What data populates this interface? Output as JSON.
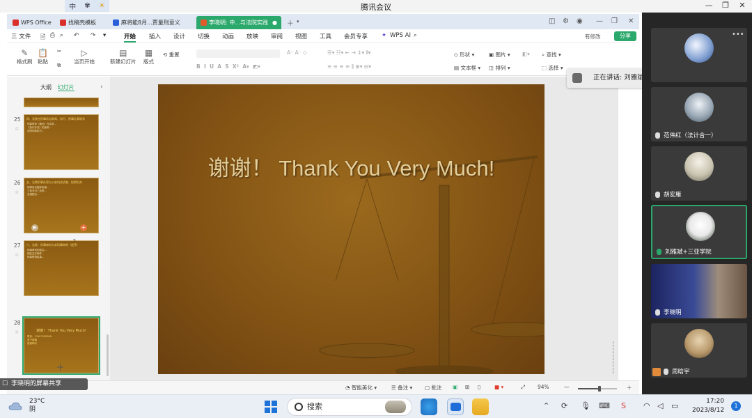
{
  "meeting": {
    "title": "腾讯会议",
    "ime_lang": "中",
    "speaker_toast": "正在讲话: 刘雅斌+三亚学院",
    "screen_share_label": "李晓明的屏幕共享"
  },
  "wps": {
    "tabs": [
      {
        "label": "WPS Office",
        "icon_color": "#d9302b"
      },
      {
        "label": "找稿壳模板",
        "icon_color": "#d9302b"
      },
      {
        "label": "麻将能8月...贾量刑意义",
        "icon_color": "#2b5fd9"
      },
      {
        "label": "李晓明: 中...与法院实践",
        "icon_color": "#e05a2b",
        "active": true
      }
    ],
    "menu": {
      "file": "三 文件",
      "items": [
        "开始",
        "插入",
        "设计",
        "切换",
        "动画",
        "放映",
        "审阅",
        "视图",
        "工具",
        "会员专享"
      ],
      "active": "开始",
      "ai": "WPS AI",
      "collab": "有修改",
      "share": "分享"
    },
    "ribbon": {
      "format_painter": "格式刷",
      "paste": "粘贴",
      "play_from_current": "当页开始",
      "new_slide": "新建幻灯片",
      "layout": "版式",
      "reset": "重置",
      "shape": "形状",
      "picture": "图片",
      "textbox": "文本框",
      "arrange": "排列",
      "find": "查找",
      "select": "选择"
    },
    "panel": {
      "tab_outline": "大纲",
      "tab_slides": "幻灯片",
      "thumbnails": [
        {
          "num": "25",
          "title": "四、法院在刑事诉讼审判、执行、刑事办案联系",
          "lines": [
            "刑事审判（裁判）在实质...",
            "《执行办法》的适用...",
            "法院刑事执行..."
          ]
        },
        {
          "num": "26",
          "title": "五、法院刑事办案与公安机关侦查、检察机关",
          "lines": [
            "刑事诉讼程序衔接...",
            "三机关分工负责...",
            "互相配合..."
          ]
        },
        {
          "num": "27",
          "title": "六、法院：刑事审判与非刑事审判（程序）",
          "lines": [
            "刑事审判的前沿...",
            "刑民交叉案件...",
            "刑事附带民事..."
          ]
        },
        {
          "num": "28",
          "title": "谢谢！ Thank You Very Much!",
          "lines": [
            "联系：13907585808",
            "电子邮箱",
            "感谢聆听"
          ]
        }
      ]
    },
    "slide": {
      "title": "谢谢！ Thank You Very Much!"
    },
    "statusbar": {
      "beautify": "智能美化",
      "notes": "备注",
      "comments": "批注",
      "zoom": "94%",
      "zoom_fraction": 0.55
    }
  },
  "participants": [
    {
      "name": "",
      "speaking": false,
      "avatar_color": "#7d9dcf"
    },
    {
      "name": "范伟红（法计合一）",
      "speaking": false,
      "avatar_color": "#9aa8b6"
    },
    {
      "name": "胡宏雁",
      "speaking": false,
      "avatar_color": "#c9c3b0"
    },
    {
      "name": "刘雅斌+三亚学院",
      "speaking": true,
      "avatar_color": "#e9e9e9"
    },
    {
      "name": "李晓明",
      "speaking": false,
      "video": true
    },
    {
      "name": "周晗宇",
      "speaking": false,
      "avatar_color": "#b99a6d"
    }
  ],
  "taskbar": {
    "temperature": "23°C",
    "weather": "阴",
    "search": "搜索",
    "time": "17:20",
    "date": "2023/8/12",
    "notifications": "1"
  }
}
